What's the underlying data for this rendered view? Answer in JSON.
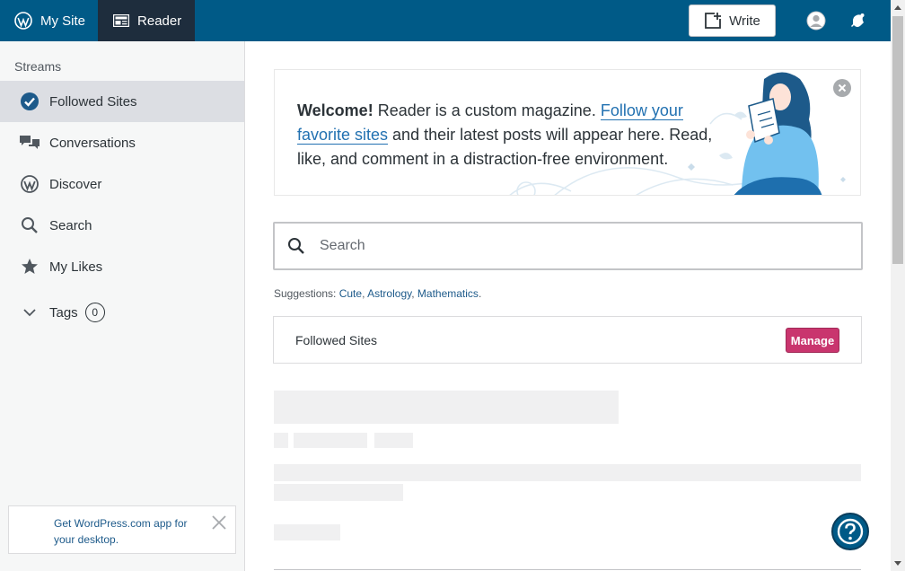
{
  "masterbar": {
    "my_site_label": "My Site",
    "reader_label": "Reader",
    "write_label": "Write",
    "brand_color": "#005a87",
    "active_color": "#1e2d3d"
  },
  "sidebar": {
    "section_title": "Streams",
    "items": [
      {
        "label": "Followed Sites",
        "icon": "check-circle-icon"
      },
      {
        "label": "Conversations",
        "icon": "chat-bubbles-icon"
      },
      {
        "label": "Discover",
        "icon": "wordpress-icon"
      },
      {
        "label": "Search",
        "icon": "search-icon"
      },
      {
        "label": "My Likes",
        "icon": "star-icon"
      }
    ],
    "tags": {
      "label": "Tags",
      "count": "0"
    },
    "app_promo": "Get WordPress.com app for your desktop."
  },
  "welcome": {
    "bold": "Welcome!",
    "text1": " Reader is a custom magazine. ",
    "link": "Follow your favorite sites",
    "text2": " and their latest posts will appear here. Read, like, and comment in a distraction-free environment."
  },
  "search": {
    "placeholder": "Search"
  },
  "suggestions": {
    "label": "Suggestions: ",
    "items": [
      "Cute",
      "Astrology",
      "Mathematics"
    ]
  },
  "followed_card": {
    "title": "Followed Sites",
    "manage_label": "Manage",
    "manage_color": "#c9356e"
  }
}
